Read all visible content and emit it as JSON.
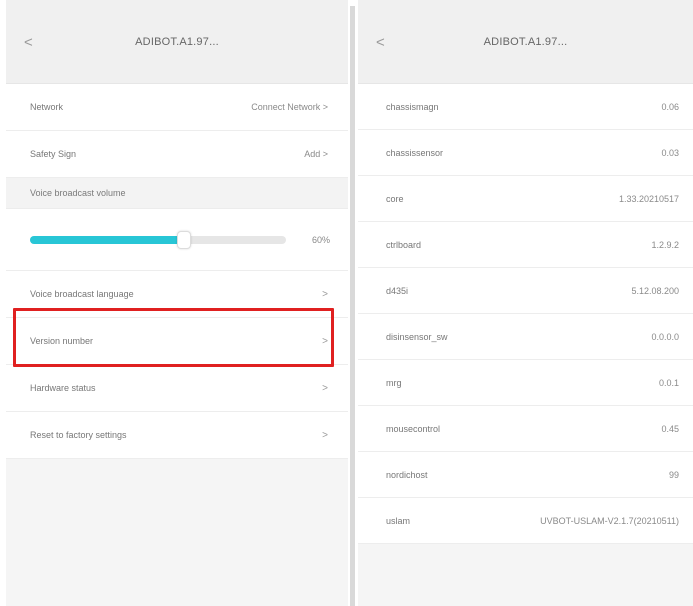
{
  "left": {
    "header": {
      "back": "<",
      "title": "ADIBOT.A1.97..."
    },
    "rows": [
      {
        "label": "Network",
        "value": "Connect Network >"
      },
      {
        "label": "Safety Sign",
        "value": "Add >"
      }
    ],
    "volume": {
      "label": "Voice broadcast volume",
      "level": 0.6,
      "percent": "60%"
    },
    "menu": [
      {
        "label": "Voice broadcast language",
        "chevron": ">"
      },
      {
        "label": "Version number",
        "chevron": ">"
      },
      {
        "label": "Hardware status",
        "chevron": ">"
      },
      {
        "label": "Reset to factory settings",
        "chevron": ">"
      }
    ]
  },
  "right": {
    "header": {
      "back": "<",
      "title": "ADIBOT.A1.97..."
    },
    "versions": [
      {
        "label": "chassismagn",
        "value": "0.06"
      },
      {
        "label": "chassissensor",
        "value": "0.03"
      },
      {
        "label": "core",
        "value": "1.33.20210517"
      },
      {
        "label": "ctrlboard",
        "value": "1.2.9.2"
      },
      {
        "label": "d435i",
        "value": "5.12.08.200"
      },
      {
        "label": "disinsensor_sw",
        "value": "0.0.0.0"
      },
      {
        "label": "mrg",
        "value": "0.0.1"
      },
      {
        "label": "mousecontrol",
        "value": "0.45"
      },
      {
        "label": "nordichost",
        "value": "99"
      },
      {
        "label": "uslam",
        "value": "UVBOT-USLAM-V2.1.7(20210511)"
      }
    ]
  },
  "colors": {
    "accent": "#28c6d6",
    "highlight": "#e02020"
  }
}
